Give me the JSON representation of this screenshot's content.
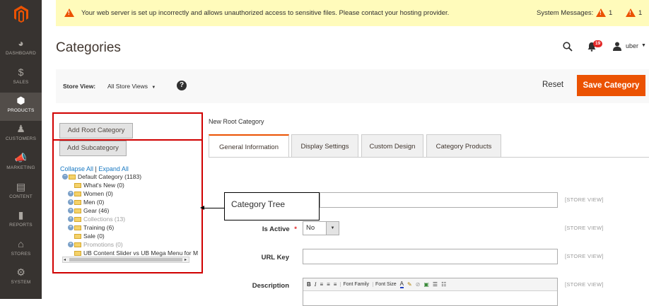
{
  "sidebar": {
    "items": [
      {
        "icon": "dashboard-icon",
        "glyph": "◕",
        "label": "DASHBOARD"
      },
      {
        "icon": "dollar-icon",
        "glyph": "$",
        "label": "SALES"
      },
      {
        "icon": "box-icon",
        "glyph": "⬢",
        "label": "PRODUCTS"
      },
      {
        "icon": "person-icon",
        "glyph": "♟",
        "label": "CUSTOMERS"
      },
      {
        "icon": "megaphone-icon",
        "glyph": "📣",
        "label": "MARKETING"
      },
      {
        "icon": "content-icon",
        "glyph": "▤",
        "label": "CONTENT"
      },
      {
        "icon": "bars-icon",
        "glyph": "▮",
        "label": "REPORTS"
      },
      {
        "icon": "store-icon",
        "glyph": "⌂",
        "label": "STORES"
      },
      {
        "icon": "gear-icon",
        "glyph": "⚙",
        "label": "SYSTEM"
      }
    ],
    "active_index": 2,
    "brand_color": "#eb5202"
  },
  "message_bar": {
    "text": "Your web server is set up incorrectly and allows unauthorized access to sensitive files. Please contact your hosting provider.",
    "system_messages_label": "System Messages:",
    "count_critical": "1",
    "count_major": "1"
  },
  "header": {
    "title": "Categories",
    "notification_count": "19",
    "user_name": "uber"
  },
  "store_bar": {
    "label": "Store View:",
    "value": "All Store Views",
    "reset_label": "Reset",
    "save_label": "Save Category"
  },
  "tree_panel": {
    "add_root_label": "Add Root Category",
    "add_sub_label": "Add Subcategory",
    "collapse_label": "Collapse All",
    "separator": "|",
    "expand_label": "Expand All",
    "nodes": [
      {
        "label": "Default Category (1183)",
        "level": 0,
        "expander": true,
        "dim": false
      },
      {
        "label": "What's New (0)",
        "level": 1,
        "expander": false,
        "dim": false
      },
      {
        "label": "Women (0)",
        "level": 1,
        "expander": true,
        "dim": false
      },
      {
        "label": "Men (0)",
        "level": 1,
        "expander": true,
        "dim": false
      },
      {
        "label": "Gear (46)",
        "level": 1,
        "expander": true,
        "dim": false
      },
      {
        "label": "Collections (13)",
        "level": 1,
        "expander": true,
        "dim": true
      },
      {
        "label": "Training (6)",
        "level": 1,
        "expander": true,
        "dim": false
      },
      {
        "label": "Sale (0)",
        "level": 1,
        "expander": false,
        "dim": false
      },
      {
        "label": "Promotions (0)",
        "level": 1,
        "expander": true,
        "dim": true
      },
      {
        "label": "UB Content Slider vs UB Mega Menu for M",
        "level": 1,
        "expander": false,
        "dim": false
      }
    ]
  },
  "editor": {
    "section_title": "New Root Category",
    "tabs": [
      "General Information",
      "Display Settings",
      "Custom Design",
      "Category Products"
    ],
    "active_tab": 0,
    "callout": "Category Tree",
    "fields": {
      "is_active_label": "Is Active",
      "is_active_value": "No",
      "url_key_label": "URL Key",
      "description_label": "Description",
      "required_mark": "*",
      "scope_label": "[STORE VIEW]"
    },
    "toolbar": {
      "font_family": "Font Family",
      "font_size": "Font Size"
    }
  }
}
